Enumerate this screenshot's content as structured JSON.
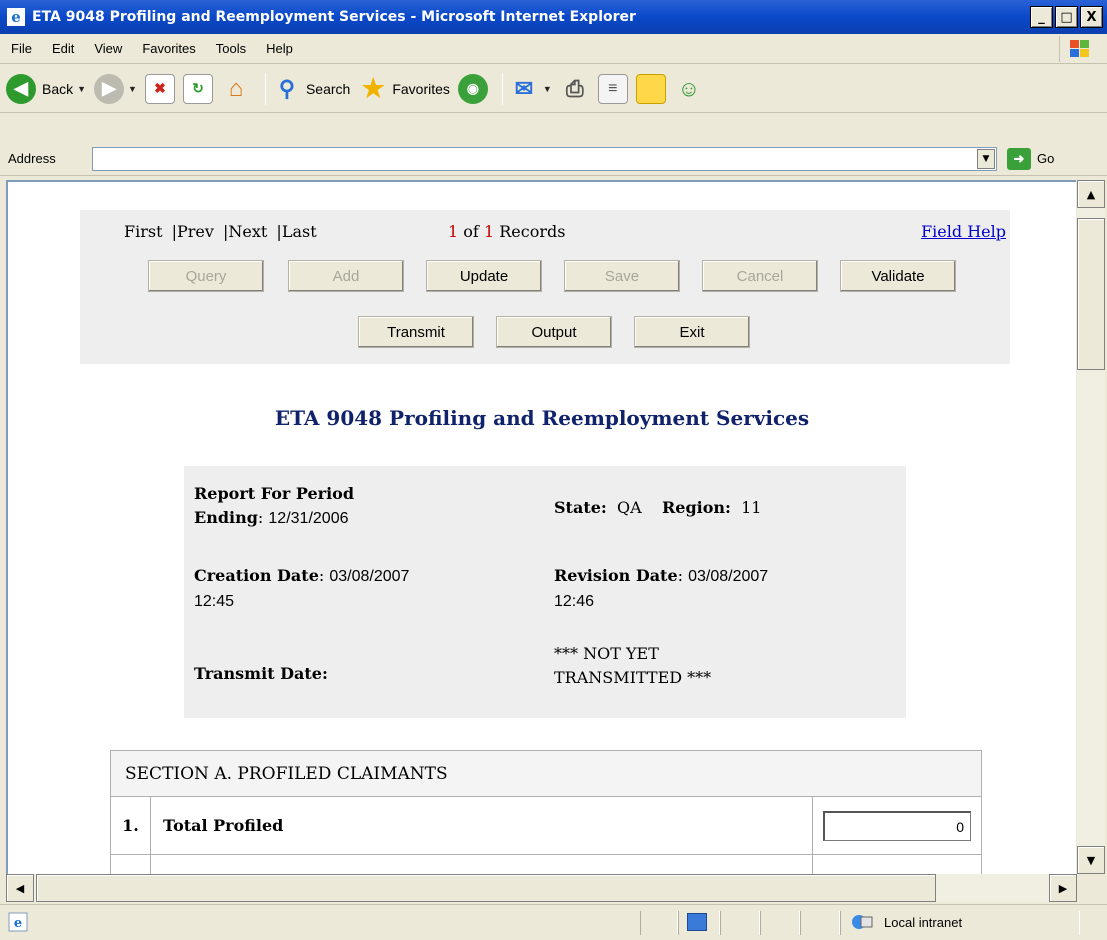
{
  "window": {
    "title": "ETA 9048 Profiling and Reemployment Services - Microsoft Internet Explorer",
    "minimize": "_",
    "maximize": "□",
    "close": "X"
  },
  "menu": [
    "File",
    "Edit",
    "View",
    "Favorites",
    "Tools",
    "Help"
  ],
  "toolbar": {
    "back_label": "Back",
    "search_label": "Search",
    "favorites_label": "Favorites"
  },
  "address": {
    "label": "Address",
    "value": "",
    "go_label": "Go"
  },
  "nav": {
    "first": "First",
    "prev": "|Prev",
    "next": "|Next",
    "last": "|Last",
    "current": "1",
    "of": "of",
    "total": "1",
    "records": "Records",
    "field_help": "Field Help"
  },
  "buttons": {
    "query": "Query",
    "add": "Add",
    "update": "Update",
    "save": "Save",
    "cancel": "Cancel",
    "validate": "Validate",
    "transmit": "Transmit",
    "output": "Output",
    "exit": "Exit"
  },
  "page_title": "ETA 9048 Profiling and Reemployment Services",
  "info": {
    "report_label_1": "Report For Period",
    "report_label_2": "Ending",
    "report_value": "12/31/2006",
    "state_label": "State:",
    "state_value": "QA",
    "region_label": "Region:",
    "region_value": "11",
    "creation_label": "Creation Date",
    "creation_value_1": "03/08/2007",
    "creation_value_2": "12:45",
    "revision_label": "Revision Date",
    "revision_value_1": "03/08/2007",
    "revision_value_2": "12:46",
    "transmit_label": "Transmit Date:",
    "transmit_value_1": "*** NOT YET",
    "transmit_value_2": "TRANSMITTED ***"
  },
  "section_a": {
    "header": "SECTION A. PROFILED CLAIMANTS",
    "rows": [
      {
        "num": "1.",
        "label": "Total Profiled",
        "value": "0"
      }
    ]
  },
  "status": {
    "zone": "Local intranet"
  },
  "colors": {
    "title_bar": "#0b49c9",
    "link": "#0000cc",
    "page_title": "#10226b",
    "record_count": "#cc0000"
  }
}
